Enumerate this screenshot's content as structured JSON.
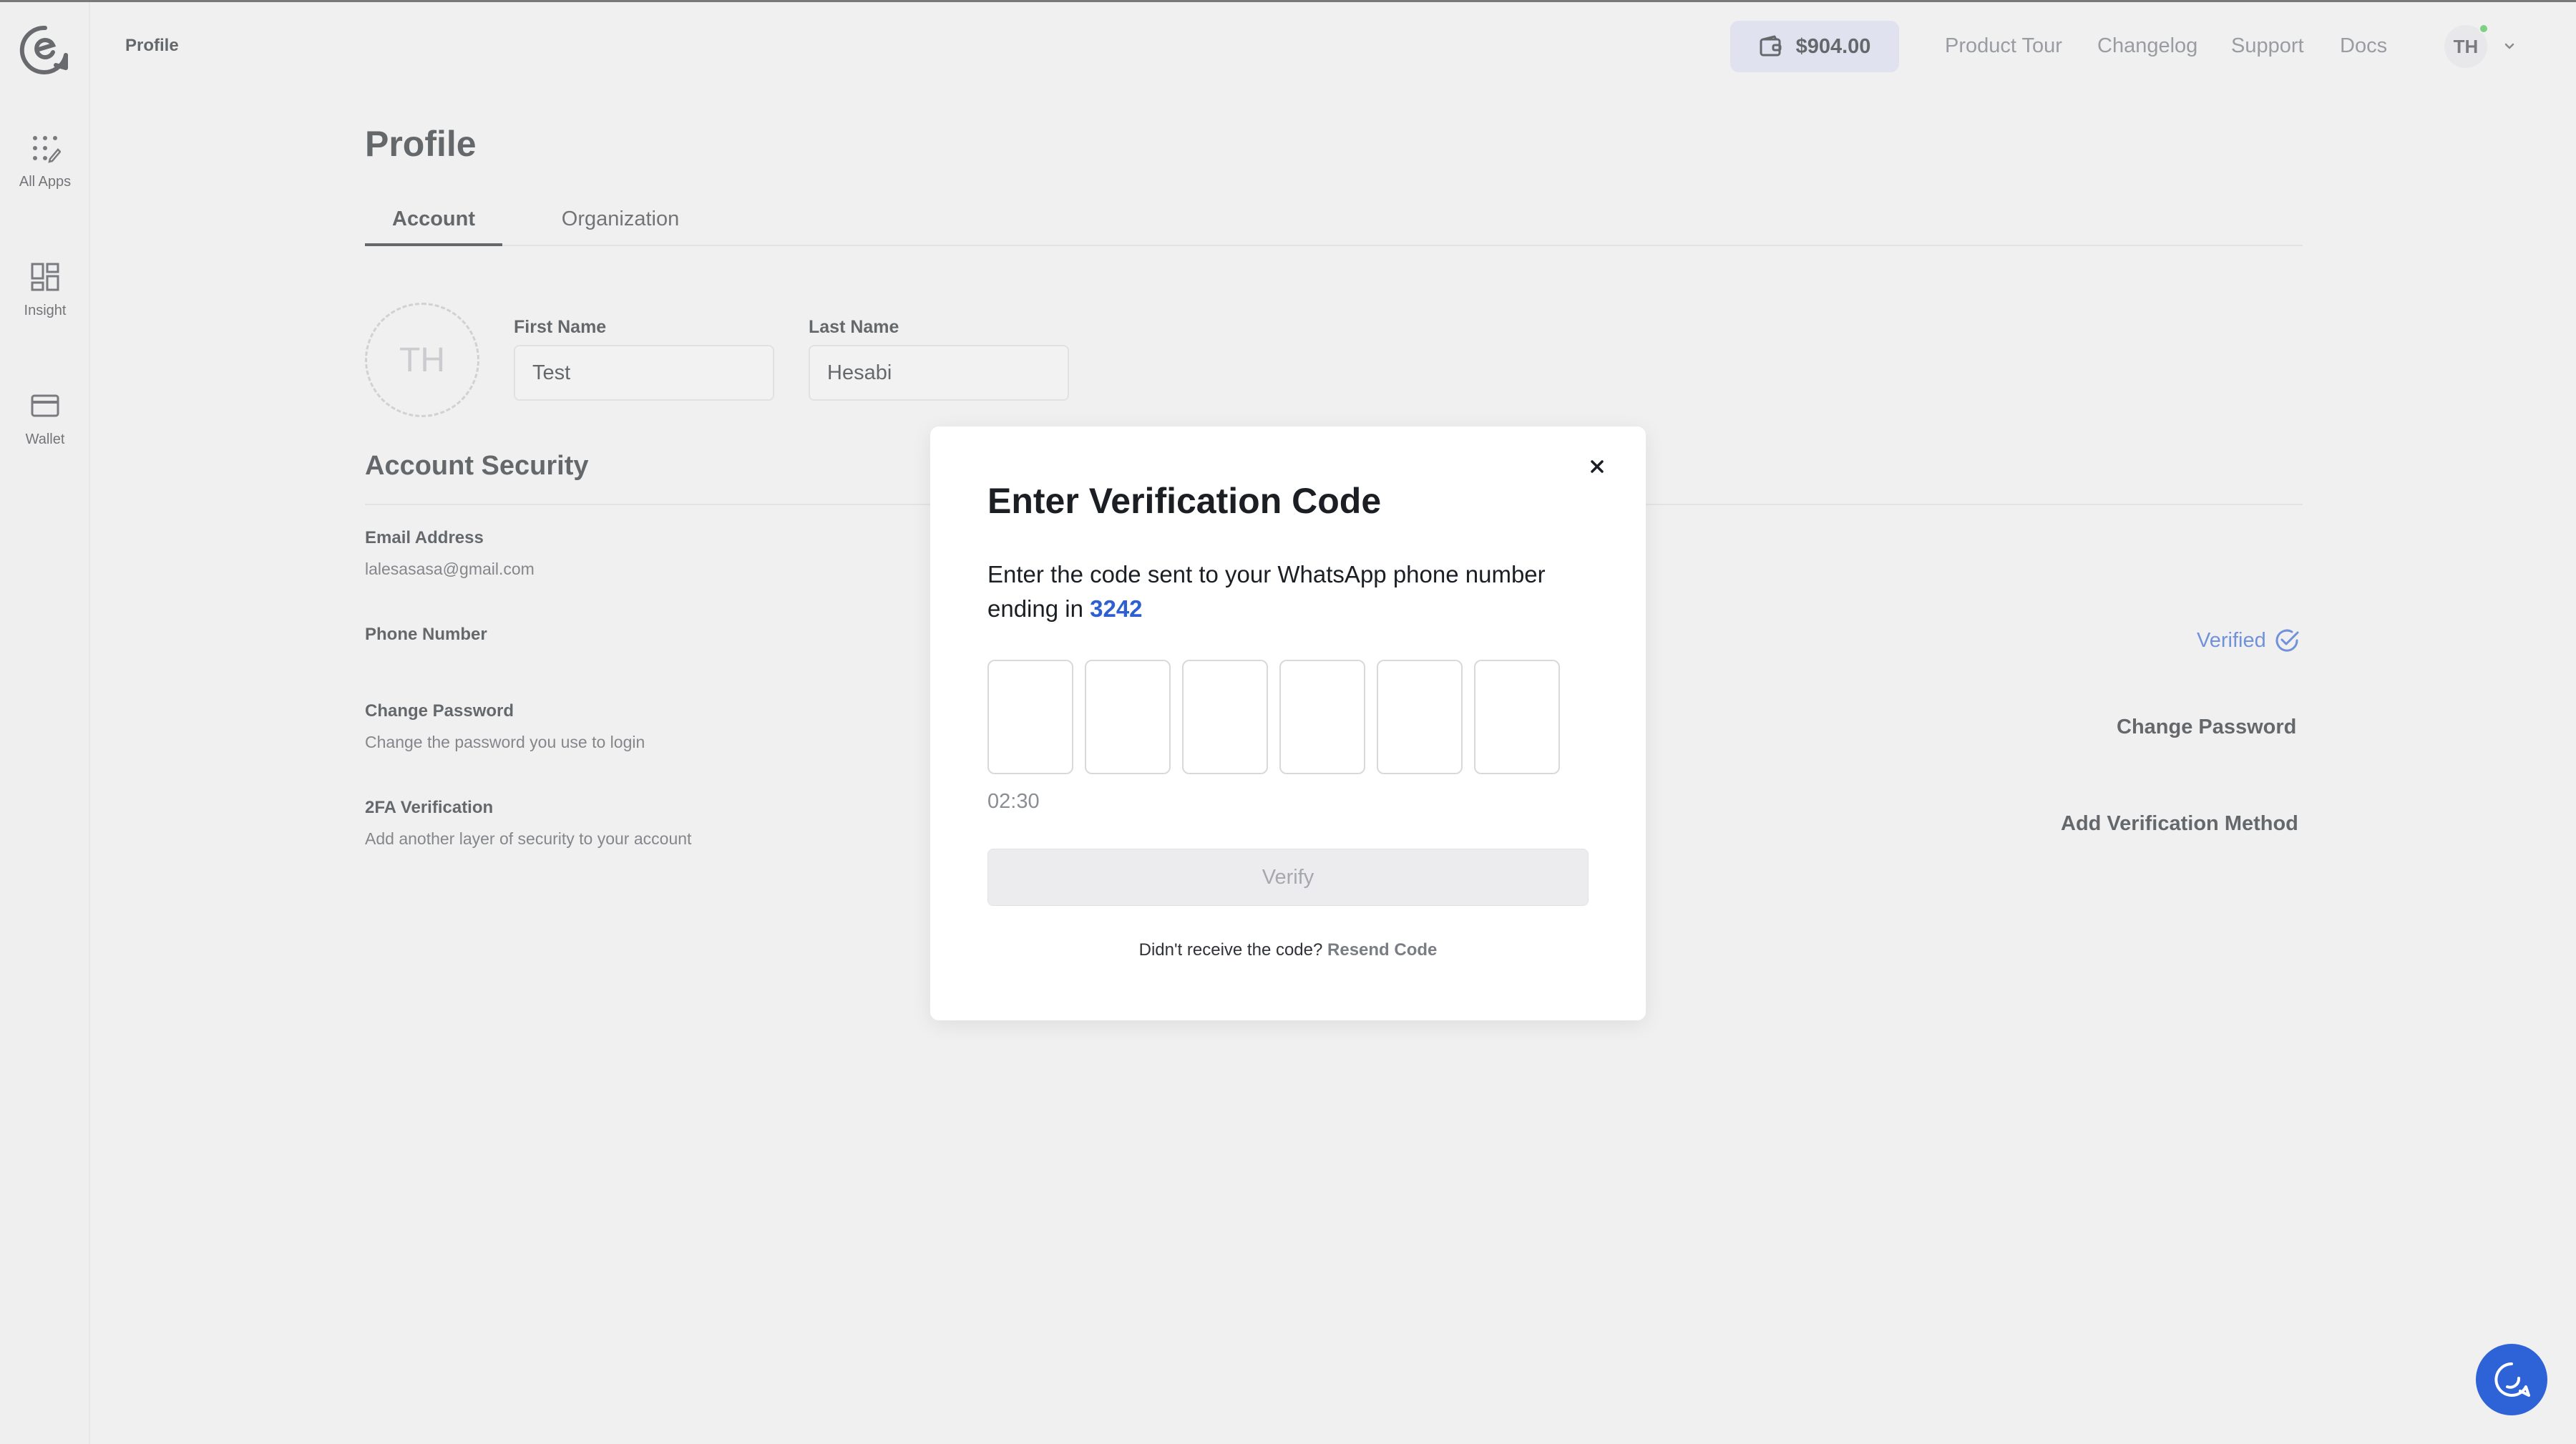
{
  "header": {
    "breadcrumb": "Profile",
    "wallet_balance": "$904.00",
    "links": [
      "Product Tour",
      "Changelog",
      "Support",
      "Docs"
    ],
    "user_initials": "TH"
  },
  "sidebar": {
    "items": [
      {
        "label": "All Apps",
        "icon": "apps-icon"
      },
      {
        "label": "Insight",
        "icon": "dashboard-icon"
      },
      {
        "label": "Wallet",
        "icon": "card-icon"
      }
    ]
  },
  "page": {
    "title": "Profile",
    "tabs": [
      "Account",
      "Organization"
    ],
    "active_tab": "Account",
    "avatar_initials": "TH",
    "first_name": {
      "label": "First Name",
      "value": "Test"
    },
    "last_name": {
      "label": "Last Name",
      "value": "Hesabi"
    },
    "security": {
      "title": "Account Security",
      "email_label": "Email Address",
      "email_value": "lalesasasa@gmail.com",
      "phone_label": "Phone Number",
      "phone_status": "Verified",
      "password_label": "Change Password",
      "password_desc": "Change the password you use to login",
      "password_action": "Change Password",
      "twofa_label": "2FA Verification",
      "twofa_desc": "Add another layer of security to your account",
      "twofa_action": "Add Verification Method"
    }
  },
  "modal": {
    "title": "Enter Verification Code",
    "desc_prefix": "Enter the code sent to your WhatsApp phone number ending in ",
    "phone_last_digits": "3242",
    "otp_length": 6,
    "otp_values": [
      "",
      "",
      "",
      "",
      "",
      ""
    ],
    "timer": "02:30",
    "verify_label": "Verify",
    "resend_prompt": "Didn't receive the code?",
    "resend_link": "Resend Code"
  },
  "colors": {
    "accent": "#2d5fd0",
    "wallet_bg": "#d7daef",
    "online": "#3fbf4a",
    "chat_fab": "#2e63d8"
  }
}
